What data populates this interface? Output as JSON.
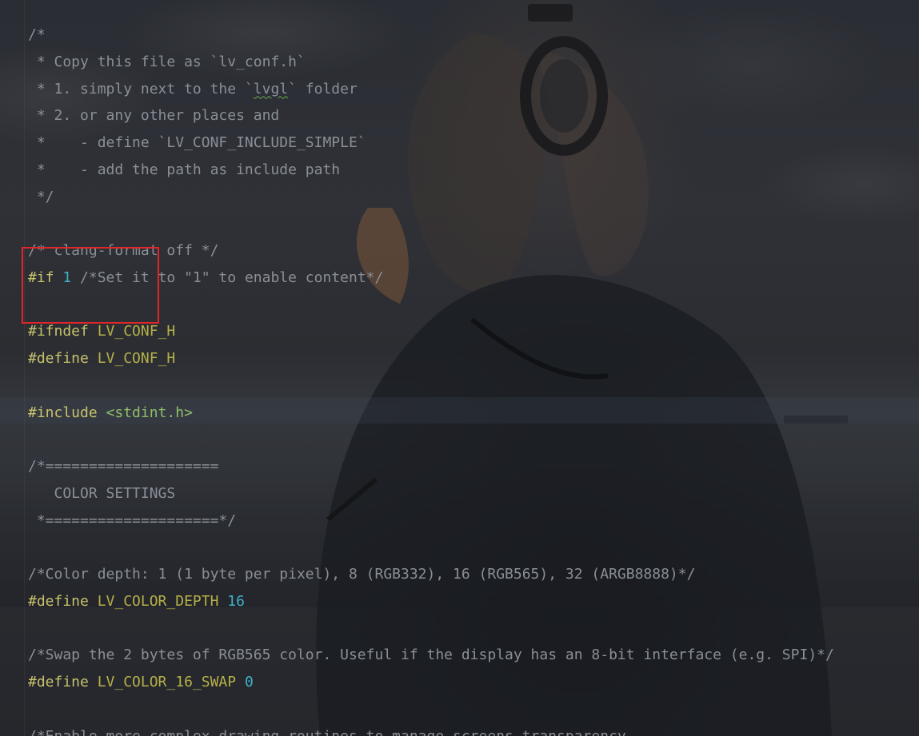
{
  "editor": {
    "highlighted_line": 15,
    "selection_box": {
      "color": "#e0262a"
    }
  },
  "code_lines": [
    [
      {
        "t": "/*",
        "c": "comment"
      }
    ],
    [
      {
        "t": " * Copy this file as `lv_conf.h`",
        "c": "comment"
      }
    ],
    [
      {
        "t": " * 1. simply next to the `",
        "c": "comment"
      },
      {
        "t": "lvgl",
        "c": "comment squiggle"
      },
      {
        "t": "` folder",
        "c": "comment"
      }
    ],
    [
      {
        "t": " * 2. or any other places and",
        "c": "comment"
      }
    ],
    [
      {
        "t": " *    - define `LV_CONF_INCLUDE_SIMPLE`",
        "c": "comment"
      }
    ],
    [
      {
        "t": " *    - add the path as include path",
        "c": "comment"
      }
    ],
    [
      {
        "t": " */",
        "c": "comment"
      }
    ],
    [],
    [
      {
        "t": "/* clang-format off */",
        "c": "comment"
      }
    ],
    [
      {
        "t": "#if",
        "c": "directive"
      },
      {
        "t": " ",
        "c": ""
      },
      {
        "t": "1",
        "c": "number"
      },
      {
        "t": " /*Set it to \"1\" to enable content*/",
        "c": "comment"
      }
    ],
    [],
    [
      {
        "t": "#ifndef",
        "c": "directive"
      },
      {
        "t": " ",
        "c": ""
      },
      {
        "t": "LV_CONF_H",
        "c": "macro"
      }
    ],
    [
      {
        "t": "#define",
        "c": "directive"
      },
      {
        "t": " ",
        "c": ""
      },
      {
        "t": "LV_CONF_H",
        "c": "macro"
      }
    ],
    [],
    [
      {
        "t": "#include",
        "c": "directive"
      },
      {
        "t": " ",
        "c": ""
      },
      {
        "t": "<stdint.h>",
        "c": "header"
      }
    ],
    [],
    [
      {
        "t": "/*====================",
        "c": "comment"
      }
    ],
    [
      {
        "t": "   COLOR SETTINGS",
        "c": "comment"
      }
    ],
    [
      {
        "t": " *====================*/",
        "c": "comment"
      }
    ],
    [],
    [
      {
        "t": "/*Color depth: 1 (1 byte per pixel), 8 (RGB332), 16 (RGB565), 32 (ARGB8888)*/",
        "c": "comment"
      }
    ],
    [
      {
        "t": "#define",
        "c": "directive"
      },
      {
        "t": " ",
        "c": ""
      },
      {
        "t": "LV_COLOR_DEPTH",
        "c": "macro"
      },
      {
        "t": " ",
        "c": ""
      },
      {
        "t": "16",
        "c": "number"
      }
    ],
    [],
    [
      {
        "t": "/*Swap the 2 bytes of RGB565 color. Useful if the display has an 8-bit interface (e.g. SPI)*/",
        "c": "comment"
      }
    ],
    [
      {
        "t": "#define",
        "c": "directive"
      },
      {
        "t": " ",
        "c": ""
      },
      {
        "t": "LV_COLOR_16_SWAP",
        "c": "macro"
      },
      {
        "t": " ",
        "c": ""
      },
      {
        "t": "0",
        "c": "number"
      }
    ],
    [],
    [
      {
        "t": "/*Enable more complex drawing routines to manage screens transparency.",
        "c": "comment"
      }
    ]
  ]
}
